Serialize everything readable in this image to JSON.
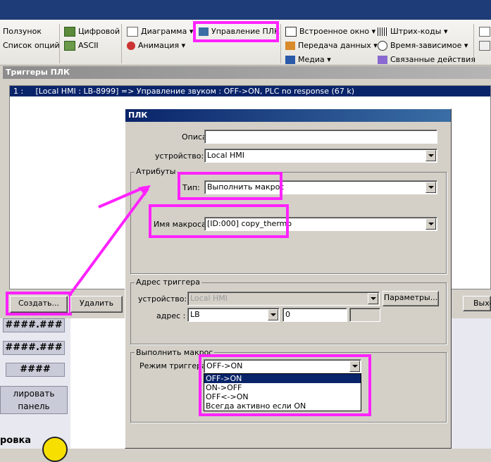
{
  "ribbon": {
    "items": {
      "slider": "Ползунок",
      "option_list": "Список опций",
      "numeric": "Цифровой",
      "ascii": "ASCII",
      "chart": "Диаграмма",
      "animation": "Анимация",
      "plc_control": "Управление ПЛК",
      "embedded_window": "Встроенное окно",
      "data_transfer": "Передача данных",
      "media": "Медиа",
      "barcodes": "Штрих-коды",
      "time_dependent": "Время-зависимое",
      "linked_actions": "Связанные действия"
    },
    "colors": {
      "highlight": "#ff22ff",
      "plc_icon": "#3a6ea5"
    }
  },
  "triggers_window": {
    "title": "Триггеры ПЛК",
    "list": [
      {
        "index": "1 :",
        "text": "[Local HMI : LB-8999] => Управление звуком : OFF->ON, PLC no response (67 k)"
      }
    ],
    "buttons": {
      "create": "Создать...",
      "delete": "Удалить",
      "exit": "Выхо"
    }
  },
  "side_panel": {
    "items": [
      "####.###",
      "####.###",
      "####",
      "лировать\nпанель",
      "ровка"
    ]
  },
  "plc_dialog": {
    "title": "ПЛК",
    "description_label": "Описание:",
    "description_value": "",
    "device_label": "устройство:",
    "device_value": "Local HMI",
    "attributes_group": "Атрибуты",
    "type_label": "Тип:",
    "type_value": "Выполнить макрос",
    "macro_name_label": "Имя макроса:",
    "macro_name_value": "[ID:000] copy_thermo",
    "trigger_address_group": "Адрес триггера",
    "address_device_label": "устройство:",
    "address_device_value": "Local HMI",
    "params_button": "Параметры...",
    "address_label": "адрес :",
    "address_type": "LB",
    "address_value": "0",
    "exec_macro_group": "Выполнить макрос",
    "trigger_mode_label": "Режим триггера:",
    "trigger_mode_value": "OFF->ON",
    "trigger_mode_options": [
      "OFF->ON",
      "ON->OFF",
      "OFF<->ON",
      "Всегда активно если ON"
    ],
    "selected_option_index": 0
  }
}
